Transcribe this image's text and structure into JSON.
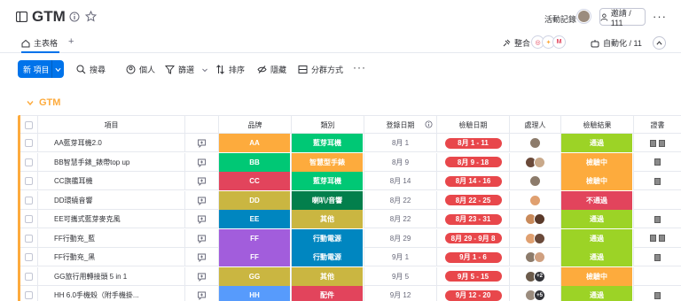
{
  "board": {
    "title": "GTM",
    "activity_label": "活動記錄",
    "invite_label": "邀請 / 111",
    "more_label": "···"
  },
  "views": {
    "main_tab": "主表格",
    "add_tab": "+",
    "integrate_label": "整合",
    "integrate_logos": [
      "◎",
      "✦",
      "M"
    ],
    "automate_label": "自動化 / 11"
  },
  "toolbar": {
    "new_item_label": "新 項目",
    "search_label": "搜尋",
    "person_label": "個人",
    "filter_label": "篩選",
    "sort_label": "排序",
    "hide_label": "隱藏",
    "groupby_label": "分群方式",
    "more_label": "···"
  },
  "group": {
    "title": "GTM",
    "color": "#fdab3d"
  },
  "columns": {
    "item": "項目",
    "brand": "品牌",
    "category": "類別",
    "register_date": "登錄日期",
    "check_date": "檢驗日期",
    "owner": "處理人",
    "result": "檢驗結果",
    "certificate": "證書"
  },
  "rows": [
    {
      "name": "AA藍芽耳機2.0",
      "brand": "AA",
      "brand_color": "#fdab3d",
      "category": "藍芽耳機",
      "category_color": "#00c875",
      "register": "8月 1",
      "check": "8月 1 - 11",
      "owners": [
        "#8c7b6b"
      ],
      "owner_extra": "",
      "result": "通過",
      "result_color": "#9cd326",
      "files": 2
    },
    {
      "name": "BB智慧手錶_錶帶top up",
      "brand": "BB",
      "brand_color": "#00c875",
      "category": "智慧型手錶",
      "category_color": "#fdab3d",
      "register": "8月 9",
      "check": "8月 9 - 18",
      "owners": [
        "#6b4a3a",
        "#c9a98a"
      ],
      "owner_extra": "",
      "result": "檢驗中",
      "result_color": "#fdab3d",
      "files": 1
    },
    {
      "name": "CC旗艦耳機",
      "brand": "CC",
      "brand_color": "#e2445c",
      "category": "藍芽耳機",
      "category_color": "#00c875",
      "register": "8月 14",
      "check": "8月 14 - 16",
      "owners": [
        "#8c7b6b"
      ],
      "owner_extra": "",
      "result": "檢驗中",
      "result_color": "#fdab3d",
      "files": 1
    },
    {
      "name": "DD環繞音響",
      "brand": "DD",
      "brand_color": "#cab641",
      "category": "喇叭/音響",
      "category_color": "#037f4c",
      "register": "8月 22",
      "check": "8月 22 - 25",
      "owners": [
        "#e0a070"
      ],
      "owner_extra": "",
      "result": "不通過",
      "result_color": "#e2445c",
      "files": 0
    },
    {
      "name": "EE可攜式藍芽麥克風",
      "brand": "EE",
      "brand_color": "#0086c0",
      "category": "其他",
      "category_color": "#cab641",
      "register": "8月 22",
      "check": "8月 23 - 31",
      "owners": [
        "#c98a5a",
        "#5b3a2a"
      ],
      "owner_extra": "",
      "result": "通過",
      "result_color": "#9cd326",
      "files": 1
    },
    {
      "name": "FF行動充_藍",
      "brand": "FF",
      "brand_color": "#a25ddc",
      "category": "行動電源",
      "category_color": "#0086c0",
      "register": "8月 29",
      "check": "8月 29 - 9月 8",
      "owners": [
        "#e0a070",
        "#6b4a3a"
      ],
      "owner_extra": "",
      "result": "通過",
      "result_color": "#9cd326",
      "files": 2
    },
    {
      "name": "FF行動充_黑",
      "brand": "FF",
      "brand_color": "#a25ddc",
      "category": "行動電源",
      "category_color": "#0086c0",
      "register": "9月 1",
      "check": "9月 1 - 6",
      "owners": [
        "#8c7b6b",
        "#d0a080"
      ],
      "owner_extra": "",
      "result": "通過",
      "result_color": "#9cd326",
      "files": 1
    },
    {
      "name": "GG旅行用轉接頭 5 in 1",
      "brand": "GG",
      "brand_color": "#cab641",
      "category": "其他",
      "category_color": "#cab641",
      "register": "9月 5",
      "check": "9月 5 - 15",
      "owners": [
        "#6b5b4b"
      ],
      "owner_extra": "+2",
      "result": "檢驗中",
      "result_color": "#fdab3d",
      "files": 0
    },
    {
      "name": "HH 6.0手機殼（附手機掛...",
      "brand": "HH",
      "brand_color": "#579bfc",
      "category": "配件",
      "category_color": "#e2445c",
      "register": "9月 12",
      "check": "9月 12 - 20",
      "owners": [
        "#9b8c7e"
      ],
      "owner_extra": "+5",
      "result": "通過",
      "result_color": "#9cd326",
      "files": 1
    }
  ]
}
